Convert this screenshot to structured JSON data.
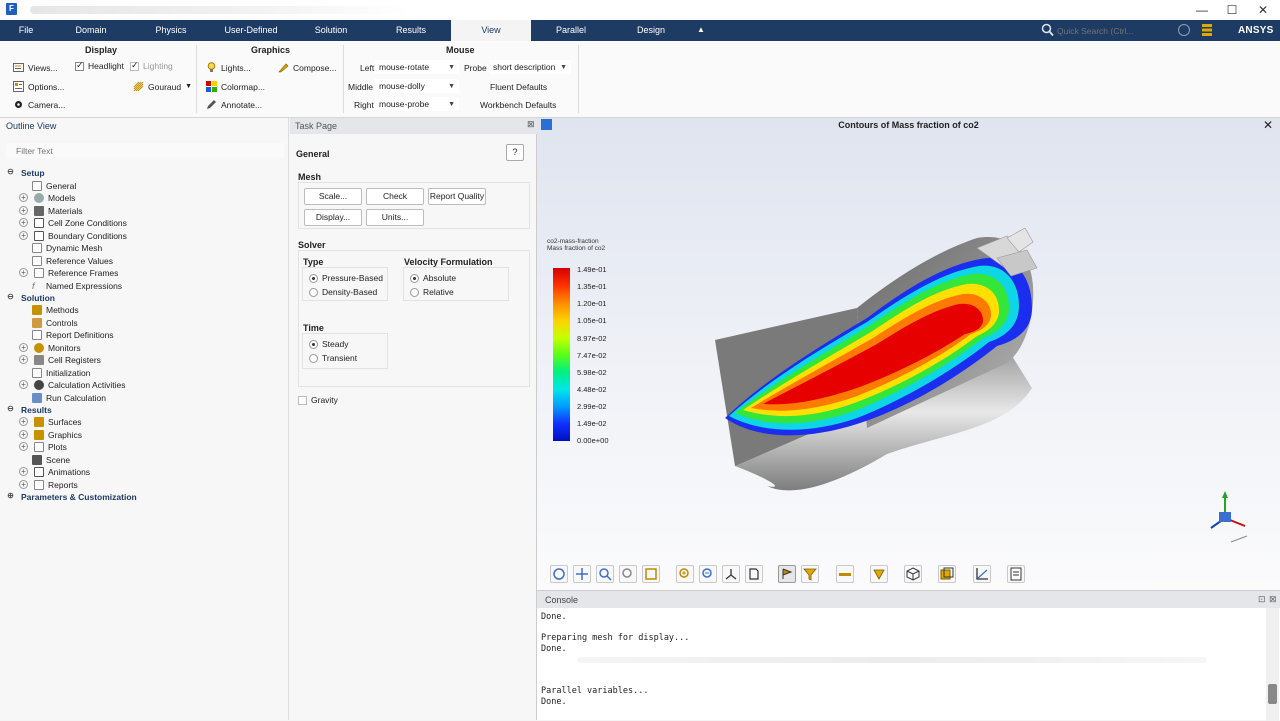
{
  "window": {
    "app_icon": "F",
    "controls": [
      "—",
      "☐",
      "✕"
    ]
  },
  "ribbon_tabs": [
    {
      "label": "File"
    },
    {
      "label": "Domain"
    },
    {
      "label": "Physics"
    },
    {
      "label": "User-Defined"
    },
    {
      "label": "Solution"
    },
    {
      "label": "Results"
    },
    {
      "label": "View"
    },
    {
      "label": "Parallel"
    },
    {
      "label": "Design"
    }
  ],
  "search": {
    "placeholder": "Quick Search (Ctrl..."
  },
  "brand": "ANSYS",
  "ribbon": {
    "display": {
      "title": "Display",
      "views": "Views...",
      "headlight": "Headlight",
      "lighting": "Lighting",
      "options": "Options...",
      "gouraud": "Gouraud",
      "camera": "Camera..."
    },
    "graphics": {
      "title": "Graphics",
      "lights": "Lights...",
      "compose": "Compose...",
      "colormap": "Colormap...",
      "annotate": "Annotate..."
    },
    "mouse": {
      "title": "Mouse",
      "left_label": "Left",
      "left_value": "mouse-rotate",
      "middle_label": "Middle",
      "middle_value": "mouse-dolly",
      "right_label": "Right",
      "right_value": "mouse-probe",
      "probe_label": "Probe",
      "probe_value": "short description",
      "fluent_defaults": "Fluent Defaults",
      "workbench_defaults": "Workbench Defaults"
    }
  },
  "outline": {
    "title": "Outline View",
    "filter_placeholder": "Filter Text",
    "items": [
      {
        "label": "Setup"
      },
      {
        "label": "General"
      },
      {
        "label": "Models"
      },
      {
        "label": "Materials"
      },
      {
        "label": "Cell Zone Conditions"
      },
      {
        "label": "Boundary Conditions"
      },
      {
        "label": "Dynamic Mesh"
      },
      {
        "label": "Reference Values"
      },
      {
        "label": "Reference Frames"
      },
      {
        "label": "Named Expressions"
      },
      {
        "label": "Solution"
      },
      {
        "label": "Methods"
      },
      {
        "label": "Controls"
      },
      {
        "label": "Report Definitions"
      },
      {
        "label": "Monitors"
      },
      {
        "label": "Cell Registers"
      },
      {
        "label": "Initialization"
      },
      {
        "label": "Calculation Activities"
      },
      {
        "label": "Run Calculation"
      },
      {
        "label": "Results"
      },
      {
        "label": "Surfaces"
      },
      {
        "label": "Graphics"
      },
      {
        "label": "Plots"
      },
      {
        "label": "Scene"
      },
      {
        "label": "Animations"
      },
      {
        "label": "Reports"
      },
      {
        "label": "Parameters & Customization"
      }
    ]
  },
  "task_page": {
    "title": "Task Page",
    "section": "General",
    "mesh": {
      "title": "Mesh",
      "scale": "Scale...",
      "check": "Check",
      "report_quality": "Report Quality",
      "display": "Display...",
      "units": "Units..."
    },
    "solver": {
      "title": "Solver",
      "type_title": "Type",
      "pressure_based": "Pressure-Based",
      "density_based": "Density-Based",
      "velocity_title": "Velocity Formulation",
      "absolute": "Absolute",
      "relative": "Relative",
      "time_title": "Time",
      "steady": "Steady",
      "transient": "Transient"
    },
    "gravity": "Gravity"
  },
  "graphics_window": {
    "title": "Contours of Mass fraction of co2",
    "legend_title_1": "co2-mass-fraction",
    "legend_title_2": "Mass fraction of co2",
    "legend_values": [
      "1.49e-01",
      "1.35e-01",
      "1.20e-01",
      "1.05e-01",
      "8.97e-02",
      "7.47e-02",
      "5.98e-02",
      "4.48e-02",
      "2.99e-02",
      "1.49e-02",
      "0.00e+00"
    ]
  },
  "console": {
    "title": "Console",
    "lines": [
      "Done.",
      "Preparing mesh for display...",
      "Done.",
      "Parallel variables...",
      "Done."
    ]
  }
}
